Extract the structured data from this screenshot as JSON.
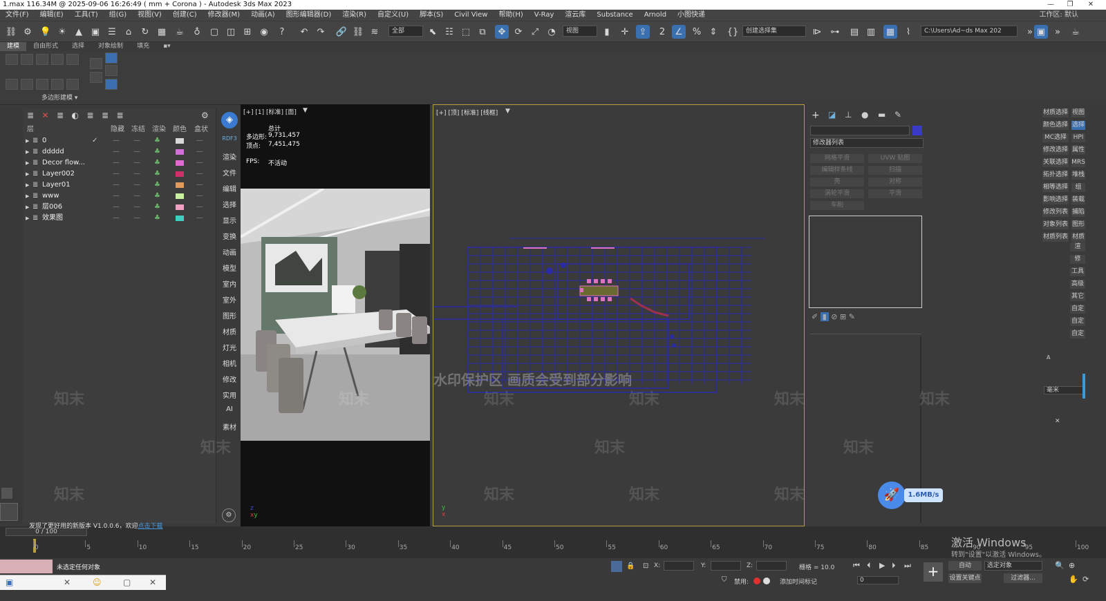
{
  "title": "1.max  116.34M @ 2025-09-06 16:26:49  ( mm + Corona ) - Autodesk 3ds Max 2023",
  "menu": [
    "文件(F)",
    "编辑(E)",
    "工具(T)",
    "组(G)",
    "视图(V)",
    "创建(C)",
    "修改器(M)",
    "动画(A)",
    "图形编辑器(D)",
    "渲染(R)",
    "自定义(U)",
    "脚本(S)",
    "Civil View",
    "帮助(H)",
    "V-Ray",
    "渲云库",
    "Substance",
    "Arnold",
    "小图快递"
  ],
  "workspace": "工作区: 默认",
  "toolbar": {
    "selection_filter": "全部",
    "ref_coord": "视图",
    "named_selection": "创建选择集",
    "path": "C:\\Users\\Ad~ds Max 202"
  },
  "ribbon": {
    "tabs": [
      "建模",
      "自由形式",
      "选择",
      "对象绘制",
      "填充"
    ],
    "group_label": "多边形建模 ▾"
  },
  "layers": {
    "headers": [
      "层",
      "隐藏",
      "冻结",
      "渲染",
      "颜色",
      "盒状"
    ],
    "rows": [
      {
        "name": "0",
        "color": "#d8d8d8",
        "current": "✓"
      },
      {
        "name": "ddddd",
        "color": "#d070d8",
        "current": ""
      },
      {
        "name": "Decor flow...",
        "color": "#e06ad0",
        "current": ""
      },
      {
        "name": "Layer002",
        "color": "#d0306a",
        "current": ""
      },
      {
        "name": "Layer01",
        "color": "#e09a5a",
        "current": ""
      },
      {
        "name": "www",
        "color": "#c8f0a0",
        "current": ""
      },
      {
        "name": "层006",
        "color": "#f0a0c0",
        "current": ""
      },
      {
        "name": "效果图",
        "color": "#40d0c0",
        "current": ""
      }
    ]
  },
  "sidenav": [
    "RDF3",
    "渲染",
    "文件",
    "编辑",
    "选择",
    "显示",
    "变换",
    "动画",
    "模型",
    "室内",
    "室外",
    "图形",
    "材质",
    "灯光",
    "相机",
    "修改",
    "实用",
    "AI",
    "素材"
  ],
  "viewport_left": {
    "label": "[+] [1] [标准] [面]",
    "stats_title": "总计",
    "polys_label": "多边形:",
    "polys": "9,731,457",
    "verts_label": "顶点:",
    "verts": "7,451,475",
    "fps_label": "FPS:",
    "fps": "不活动"
  },
  "viewport_right": {
    "label": "[+] [顶] [标准] [线框]",
    "watermark_text": "水印保护区   画质会受到部分影响"
  },
  "command_panel": {
    "modifier_list": "修改器列表",
    "buttons": [
      "网格平滑",
      "UVW 贴图",
      "编辑样条线",
      "扫描",
      "壳",
      "对称",
      "涡轮平滑",
      "平滑",
      "车削"
    ]
  },
  "right_buttons": [
    [
      "材质选择",
      "视图"
    ],
    [
      "颜色选择",
      "选择"
    ],
    [
      "MC选择",
      "HPI"
    ],
    [
      "修改选择",
      "属性"
    ],
    [
      "关联选择",
      "MRS"
    ],
    [
      "拓扑选择",
      "堆栈"
    ],
    [
      "相等选择",
      "组"
    ],
    [
      "影响选择",
      "装载"
    ],
    [
      "修改列表",
      "捕陷"
    ],
    [
      "对象列表",
      "图形"
    ],
    [
      "材质列表",
      "材质"
    ]
  ],
  "right_side_small": [
    "渲",
    "修",
    "工具",
    "高级",
    "其它",
    "自定",
    "自定",
    "自定"
  ],
  "speed_badge": "1.6MB/s",
  "timeline": {
    "frame": "0 / 100",
    "ticks": [
      "0",
      "5",
      "10",
      "15",
      "20",
      "25",
      "30",
      "35",
      "40",
      "45",
      "50",
      "55",
      "60",
      "65",
      "70",
      "75",
      "80",
      "85",
      "90",
      "95",
      "100"
    ]
  },
  "status": {
    "notice": "发现了更好用的新版本 V1.0.0.6，欢迎",
    "notice_link": "点击下载",
    "selection": "未选定任何对象",
    "x_label": "X:",
    "y_label": "Y:",
    "z_label": "Z:",
    "grid": "栅格 = 10.0",
    "disabled": "禁用:",
    "add_time_tag": "添加时间标记",
    "auto": "自动",
    "selected_object": "选定对象",
    "set_key": "设置关键点",
    "filters": "过滤器...",
    "units": "毫米",
    "activate_windows": "激活 Windows",
    "activate_sub": "转到\"设置\"以激活 Windows。"
  },
  "watermark": "知末"
}
